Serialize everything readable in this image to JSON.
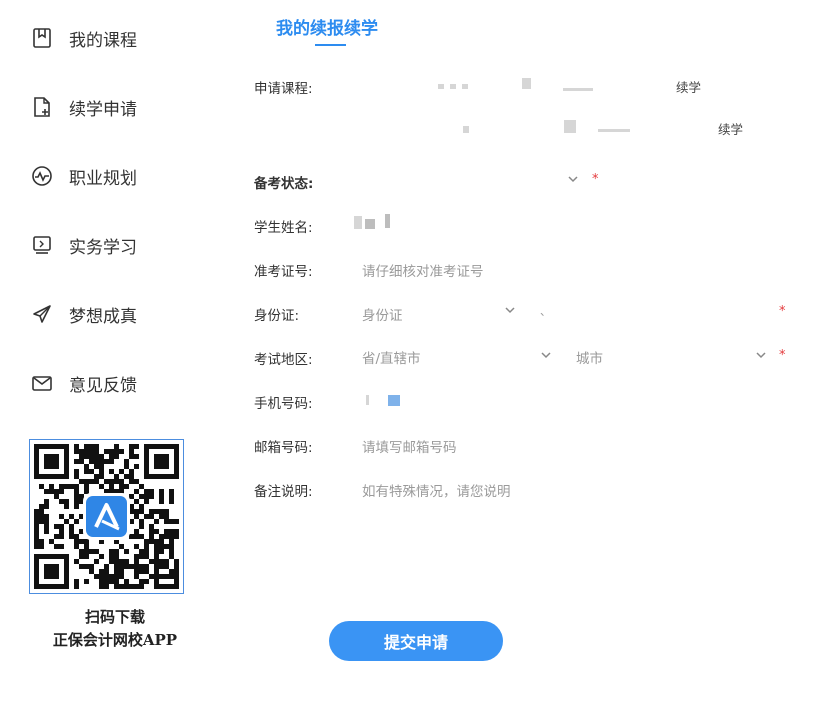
{
  "sidebar": {
    "items": [
      {
        "label": "我的课程",
        "icon": "bookmark-icon"
      },
      {
        "label": "续学申请",
        "icon": "file-add-icon"
      },
      {
        "label": "职业规划",
        "icon": "pulse-circle-icon"
      },
      {
        "label": "实务学习",
        "icon": "monitor-icon"
      },
      {
        "label": "梦想成真",
        "icon": "paper-plane-icon"
      },
      {
        "label": "意见反馈",
        "icon": "envelope-icon"
      }
    ],
    "qr": {
      "caption_line1": "扫码下载",
      "caption_line2": "正保会计网校APP"
    }
  },
  "main": {
    "tab_title": "我的续报续学",
    "form": {
      "course": {
        "label": "申请课程:",
        "items": [
          {
            "suffix": "续学"
          },
          {
            "suffix": "续学"
          }
        ]
      },
      "exam_status": {
        "label": "备考状态:"
      },
      "student_name": {
        "label": "学生姓名:"
      },
      "ticket_no": {
        "label": "准考证号:",
        "placeholder": "请仔细核对准考证号"
      },
      "id_card": {
        "label": "身份证:",
        "select_value": "身份证",
        "separator": "、"
      },
      "exam_region": {
        "label": "考试地区:",
        "province_placeholder": "省/直辖市",
        "city_placeholder": "城市"
      },
      "phone": {
        "label": "手机号码:"
      },
      "email": {
        "label": "邮箱号码:",
        "placeholder": "请填写邮箱号码"
      },
      "remark": {
        "label": "备注说明:",
        "placeholder": "如有特殊情况，请您说明"
      },
      "required_mark": "*"
    },
    "submit_label": "提交申请"
  },
  "colors": {
    "accent": "#2d8cf0",
    "button": "#3a94f4",
    "required": "#e4393c",
    "qr_border": "#4c8ddf"
  }
}
